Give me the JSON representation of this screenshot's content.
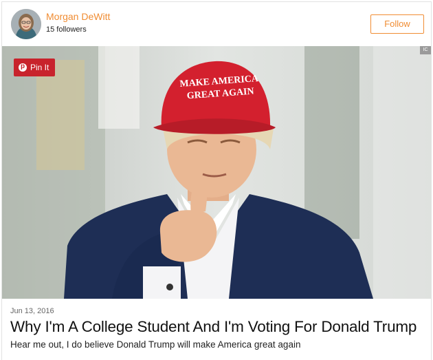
{
  "header": {
    "author_name": "Morgan DeWitt",
    "followers": "15 followers",
    "follow_label": "Follow"
  },
  "hero": {
    "pin_label": "Pin It",
    "corner_badge": "IC",
    "hat_text_line1": "MAKE AMERICA",
    "hat_text_line2": "GREAT AGAIN"
  },
  "article": {
    "date": "Jun 13, 2016",
    "title": "Why I'm A College Student And I'm Voting For Donald Trump",
    "subtitle": "Hear me out, I do believe Donald Trump will make America great again"
  },
  "colors": {
    "accent": "#f08c32",
    "pin": "#c8232c"
  },
  "icons": {
    "pin": "pinterest-icon",
    "avatar": "avatar"
  }
}
